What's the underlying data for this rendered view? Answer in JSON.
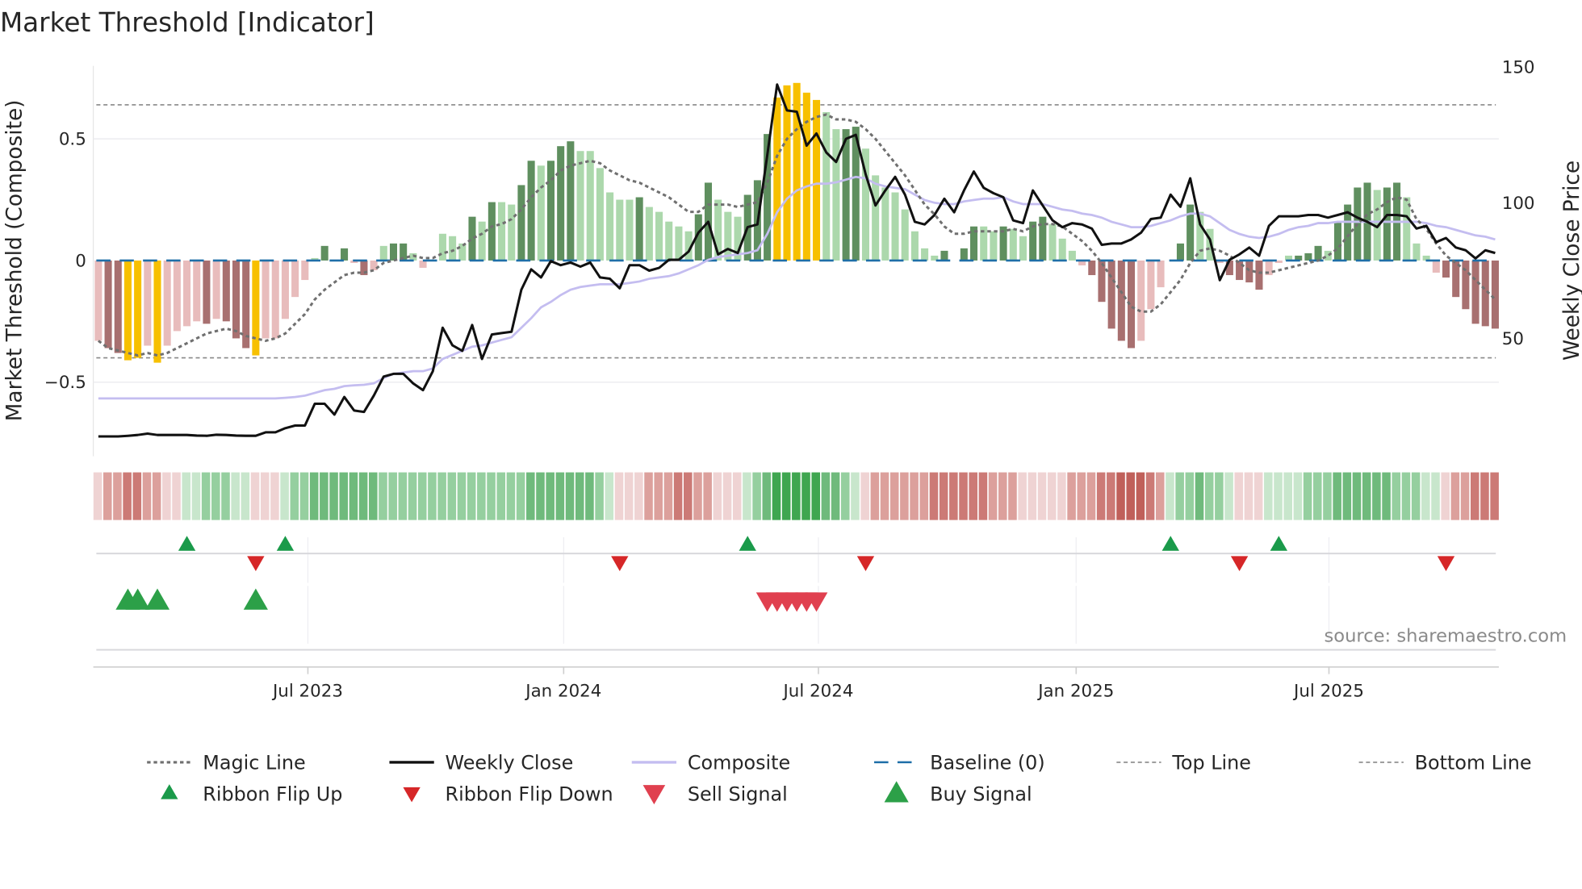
{
  "title": "Market Threshold [Indicator]",
  "source": "source: sharemaestro.com",
  "colors": {
    "dark_green": "#5f8f5f",
    "light_green": "#acd8ac",
    "dark_red": "#a87070",
    "light_red": "#e8bcbc",
    "yellow": "#f7c000",
    "close": "#111111",
    "composite": "#c4bdf0",
    "magic": "#707070",
    "baseline": "#1f6fa8",
    "threshold": "#888888",
    "flip_up": "#1a9a4a",
    "flip_down": "#d62728",
    "sell": "#e0404f",
    "buy": "#2ca048",
    "ribbon": {
      "-4": "#c0605a",
      "-3": "#cc7a76",
      "-2": "#dca09c",
      "-1": "#efd3d3",
      "1": "#c8e6cc",
      "2": "#95cf9f",
      "3": "#6fba7c",
      "4": "#3fa650"
    }
  },
  "chart_data": {
    "type": "bar",
    "title": "Market Threshold [Indicator]",
    "ylabel": "Market Threshold (Composite)",
    "y2label": "Weekly Close Price",
    "ylim": [
      -0.8,
      0.8
    ],
    "y2lim": [
      0,
      150
    ],
    "yticks": [
      {
        "v": 0.5,
        "label": "0.5"
      },
      {
        "v": 0,
        "label": "0"
      },
      {
        "v": -0.5,
        "label": "−0.5"
      }
    ],
    "y2ticks": [
      {
        "v": 150,
        "label": "150"
      },
      {
        "v": 100,
        "label": "100"
      },
      {
        "v": 50,
        "label": "50"
      }
    ],
    "xticks": [
      {
        "week": 22.3,
        "label": "Jul 2023"
      },
      {
        "week": 48.3,
        "label": "Jan 2024"
      },
      {
        "week": 74.2,
        "label": "Jul 2024"
      },
      {
        "week": 100.4,
        "label": "Jan 2025"
      },
      {
        "week": 126.1,
        "label": "Jul 2025"
      }
    ],
    "top_line": 0.64,
    "bottom_line": -0.4,
    "baseline": 0,
    "composite_bars": [
      -0.33,
      -0.36,
      -0.38,
      -0.41,
      -0.4,
      -0.35,
      -0.42,
      -0.35,
      -0.29,
      -0.27,
      -0.25,
      -0.26,
      -0.24,
      -0.25,
      -0.32,
      -0.36,
      -0.39,
      -0.32,
      -0.32,
      -0.24,
      -0.15,
      -0.08,
      0.01,
      0.06,
      0,
      0.05,
      -0.01,
      -0.06,
      -0.04,
      0.06,
      0.07,
      0.07,
      0.03,
      -0.03,
      0,
      0.11,
      0.1,
      0.07,
      0.18,
      0.16,
      0.24,
      0.24,
      0.23,
      0.31,
      0.41,
      0.39,
      0.41,
      0.47,
      0.49,
      0.45,
      0.45,
      0.38,
      0.28,
      0.25,
      0.25,
      0.26,
      0.22,
      0.2,
      0.16,
      0.14,
      0.12,
      0.19,
      0.32,
      0.25,
      0.2,
      0.18,
      0.27,
      0.33,
      0.52,
      0.67,
      0.72,
      0.73,
      0.69,
      0.66,
      0.61,
      0.54,
      0.54,
      0.55,
      0.46,
      0.35,
      0.3,
      0.28,
      0.21,
      0.12,
      0.05,
      0.02,
      0.04,
      0,
      0.05,
      0.14,
      0.14,
      0.12,
      0.14,
      0.13,
      0.1,
      0.16,
      0.18,
      0.15,
      0.09,
      0.04,
      -0.02,
      -0.06,
      -0.17,
      -0.28,
      -0.33,
      -0.36,
      -0.33,
      -0.2,
      -0.11,
      0,
      0.07,
      0.23,
      0.2,
      0.13,
      -0.01,
      -0.06,
      -0.08,
      -0.09,
      -0.12,
      -0.06,
      -0.01,
      0.02,
      0.02,
      0.03,
      0.06,
      0.04,
      0.16,
      0.23,
      0.3,
      0.32,
      0.29,
      0.3,
      0.32,
      0.26,
      0.07,
      0.02,
      -0.05,
      -0.07,
      -0.15,
      -0.2,
      -0.26,
      -0.27,
      -0.28
    ],
    "bar_colors": [
      "lr",
      "dr",
      "dr",
      "y",
      "y",
      "lr",
      "y",
      "lr",
      "lr",
      "lr",
      "lr",
      "dr",
      "lr",
      "dr",
      "dr",
      "dr",
      "y",
      "lr",
      "lr",
      "lr",
      "lr",
      "lr",
      "lg",
      "dg",
      "lg",
      "dg",
      "lr",
      "dr",
      "lr",
      "lg",
      "dg",
      "dg",
      "lg",
      "lr",
      "lg",
      "lg",
      "lg",
      "lg",
      "dg",
      "lg",
      "dg",
      "lg",
      "lg",
      "dg",
      "dg",
      "lg",
      "dg",
      "dg",
      "dg",
      "lg",
      "lg",
      "lg",
      "lg",
      "lg",
      "lg",
      "dg",
      "lg",
      "lg",
      "lg",
      "lg",
      "lg",
      "dg",
      "dg",
      "lg",
      "lg",
      "lg",
      "dg",
      "dg",
      "dg",
      "y",
      "y",
      "y",
      "y",
      "y",
      "lg",
      "lg",
      "dg",
      "dg",
      "lg",
      "lg",
      "lg",
      "lg",
      "lg",
      "lg",
      "lg",
      "lg",
      "dg",
      "lg",
      "dg",
      "dg",
      "lg",
      "lg",
      "dg",
      "lg",
      "lg",
      "dg",
      "dg",
      "lg",
      "lg",
      "lg",
      "lr",
      "dr",
      "dr",
      "dr",
      "dr",
      "dr",
      "lr",
      "lr",
      "lr",
      "lg",
      "dg",
      "dg",
      "lg",
      "lg",
      "lr",
      "dr",
      "dr",
      "dr",
      "dr",
      "lr",
      "lr",
      "lg",
      "dg",
      "dg",
      "dg",
      "lg",
      "dg",
      "dg",
      "dg",
      "dg",
      "lg",
      "dg",
      "dg",
      "lg",
      "lg",
      "lg",
      "lr",
      "dr",
      "dr",
      "dr",
      "dr",
      "dr",
      "dr"
    ],
    "weekly_close": [
      14,
      14,
      14,
      14.2,
      14.5,
      15,
      14.5,
      14.5,
      14.5,
      14.5,
      14.3,
      14.2,
      14.6,
      14.5,
      14.3,
      14.2,
      14.2,
      15.5,
      15.5,
      17,
      18,
      18,
      26,
      26,
      22,
      28.5,
      23.5,
      23,
      29,
      36,
      37,
      37,
      33.5,
      31,
      38,
      54,
      47.5,
      45.5,
      55,
      42.5,
      51.5,
      52,
      52.5,
      68,
      75.5,
      72.5,
      78.5,
      77,
      78,
      76.5,
      78,
      72.5,
      72,
      68.5,
      77,
      77,
      75,
      76,
      79,
      79,
      82,
      89,
      93,
      81,
      83,
      81.5,
      91,
      92,
      117.5,
      143.5,
      134,
      133.5,
      121,
      125.5,
      118.5,
      115,
      123.5,
      125,
      110.5,
      99,
      104.5,
      109.5,
      103,
      93,
      92,
      95.5,
      101.5,
      96.5,
      104.5,
      111.5,
      105.5,
      103.5,
      102,
      93.5,
      92.5,
      104.5,
      99,
      93.5,
      91,
      92.5,
      92,
      90.5,
      84.5,
      85,
      85,
      86.5,
      89,
      94,
      94.5,
      103,
      98.5,
      109,
      92,
      86.5,
      71.5,
      79,
      81,
      83.5,
      80.5,
      91.5,
      95,
      95,
      95,
      95.5,
      95.5,
      94.5,
      95.5,
      96.5,
      94.5,
      93,
      91,
      95.5,
      95.5,
      95,
      90.5,
      91.5,
      85.5,
      87,
      83.5,
      82.5,
      79.5,
      82.5,
      81.5
    ],
    "composite_line": [
      28,
      28,
      28,
      28,
      28,
      28,
      28,
      28,
      28,
      28,
      28,
      28,
      28,
      28,
      28,
      28,
      28,
      28,
      28,
      28.2,
      28.5,
      29,
      30,
      31,
      31.5,
      32.5,
      32.8,
      33,
      33.5,
      35.5,
      37,
      37.5,
      38,
      38,
      39,
      42.5,
      44,
      45.5,
      47,
      47.5,
      48.5,
      49.5,
      50.5,
      54,
      57.5,
      61.5,
      63.5,
      66,
      68,
      69,
      69.5,
      70,
      70,
      70,
      70.5,
      71,
      72,
      72.5,
      73,
      74,
      75.5,
      77,
      79,
      80,
      80.5,
      81,
      81.5,
      82.5,
      88.5,
      96.5,
      101.5,
      104.5,
      106,
      107,
      107,
      107.5,
      108.5,
      109.5,
      109,
      107,
      106,
      105.5,
      105,
      103,
      101,
      100,
      99.5,
      99.5,
      100.5,
      101,
      101.5,
      101.5,
      102,
      100.5,
      99.5,
      99.5,
      99.5,
      98.5,
      97.5,
      97,
      96,
      95.5,
      94.5,
      93,
      92,
      91,
      91,
      91.5,
      92.5,
      93.5,
      95,
      96,
      96,
      95,
      92.5,
      90,
      88.5,
      87.5,
      87,
      87.5,
      88.5,
      90,
      91,
      91.5,
      92.5,
      92.5,
      93,
      93,
      93,
      93,
      93,
      93,
      93,
      93,
      93,
      92.5,
      91.5,
      91,
      90,
      89,
      88,
      87.5,
      86.5
    ],
    "magic_line": [
      -0.33,
      -0.36,
      -0.37,
      -0.38,
      -0.39,
      -0.38,
      -0.39,
      -0.38,
      -0.36,
      -0.34,
      -0.32,
      -0.3,
      -0.29,
      -0.28,
      -0.29,
      -0.31,
      -0.32,
      -0.33,
      -0.32,
      -0.3,
      -0.26,
      -0.22,
      -0.16,
      -0.12,
      -0.09,
      -0.06,
      -0.05,
      -0.05,
      -0.04,
      -0.01,
      0,
      0.01,
      0.02,
      0.01,
      0.01,
      0.03,
      0.04,
      0.06,
      0.09,
      0.11,
      0.14,
      0.15,
      0.17,
      0.21,
      0.26,
      0.3,
      0.33,
      0.37,
      0.39,
      0.4,
      0.41,
      0.4,
      0.37,
      0.35,
      0.33,
      0.32,
      0.3,
      0.28,
      0.26,
      0.23,
      0.2,
      0.2,
      0.23,
      0.23,
      0.23,
      0.22,
      0.23,
      0.24,
      0.32,
      0.43,
      0.5,
      0.54,
      0.57,
      0.59,
      0.6,
      0.58,
      0.58,
      0.57,
      0.54,
      0.5,
      0.45,
      0.4,
      0.35,
      0.29,
      0.23,
      0.19,
      0.14,
      0.11,
      0.11,
      0.12,
      0.12,
      0.12,
      0.12,
      0.13,
      0.12,
      0.14,
      0.15,
      0.15,
      0.14,
      0.11,
      0.08,
      0.04,
      -0.01,
      -0.07,
      -0.13,
      -0.19,
      -0.21,
      -0.21,
      -0.18,
      -0.13,
      -0.08,
      -0.01,
      0.04,
      0.05,
      0.04,
      0.02,
      -0.01,
      -0.04,
      -0.05,
      -0.05,
      -0.04,
      -0.03,
      -0.02,
      -0.01,
      0,
      0.02,
      0.05,
      0.1,
      0.15,
      0.19,
      0.21,
      0.24,
      0.26,
      0.25,
      0.17,
      0.13,
      0.07,
      0.02,
      -0.01,
      -0.04,
      -0.08,
      -0.12,
      -0.16
    ],
    "ribbon": [
      -1,
      -2,
      -2,
      -3,
      -3,
      -2,
      -2,
      -1,
      -1,
      1,
      1,
      2,
      2,
      2,
      1,
      1,
      -1,
      -1,
      -1,
      1,
      2,
      2,
      3,
      3,
      3,
      3,
      3,
      3,
      3,
      2,
      2,
      2,
      2,
      2,
      2,
      2,
      2,
      2,
      2,
      2,
      2,
      2,
      2,
      2,
      3,
      3,
      3,
      3,
      3,
      3,
      3,
      2,
      1,
      -1,
      -1,
      -1,
      -2,
      -2,
      -2,
      -3,
      -3,
      -2,
      -2,
      -1,
      -1,
      -1,
      1,
      2,
      3,
      4,
      4,
      4,
      4,
      4,
      3,
      3,
      2,
      1,
      -1,
      -2,
      -2,
      -2,
      -2,
      -2,
      -2,
      -3,
      -3,
      -3,
      -3,
      -3,
      -3,
      -2,
      -2,
      -2,
      -1,
      -1,
      -1,
      -1,
      -1,
      -2,
      -2,
      -2,
      -3,
      -3,
      -4,
      -4,
      -4,
      -3,
      -2,
      1,
      2,
      2,
      3,
      2,
      2,
      1,
      -1,
      -1,
      -1,
      1,
      1,
      1,
      1,
      2,
      2,
      2,
      3,
      3,
      3,
      3,
      3,
      3,
      2,
      2,
      2,
      1,
      1,
      -1,
      -2,
      -2,
      -3,
      -3,
      -3
    ],
    "ribbon_flip_up": [
      10,
      20,
      67,
      110,
      121
    ],
    "ribbon_flip_down": [
      17,
      54,
      79,
      117,
      138
    ],
    "buy_signals": [
      4,
      5,
      7,
      17
    ],
    "sell_signals": [
      69,
      70,
      71,
      72,
      73,
      74
    ],
    "legend": [
      {
        "key": "magic",
        "label": "Magic Line"
      },
      {
        "key": "close",
        "label": "Weekly Close"
      },
      {
        "key": "composite",
        "label": "Composite"
      },
      {
        "key": "baseline",
        "label": "Baseline (0)"
      },
      {
        "key": "top",
        "label": "Top Line"
      },
      {
        "key": "bottom",
        "label": "Bottom Line"
      },
      {
        "key": "flip_up",
        "label": "Ribbon Flip Up"
      },
      {
        "key": "flip_down",
        "label": "Ribbon Flip Down"
      },
      {
        "key": "sell",
        "label": "Sell Signal"
      },
      {
        "key": "buy",
        "label": "Buy Signal"
      }
    ],
    "legend_placement": "bottom"
  }
}
